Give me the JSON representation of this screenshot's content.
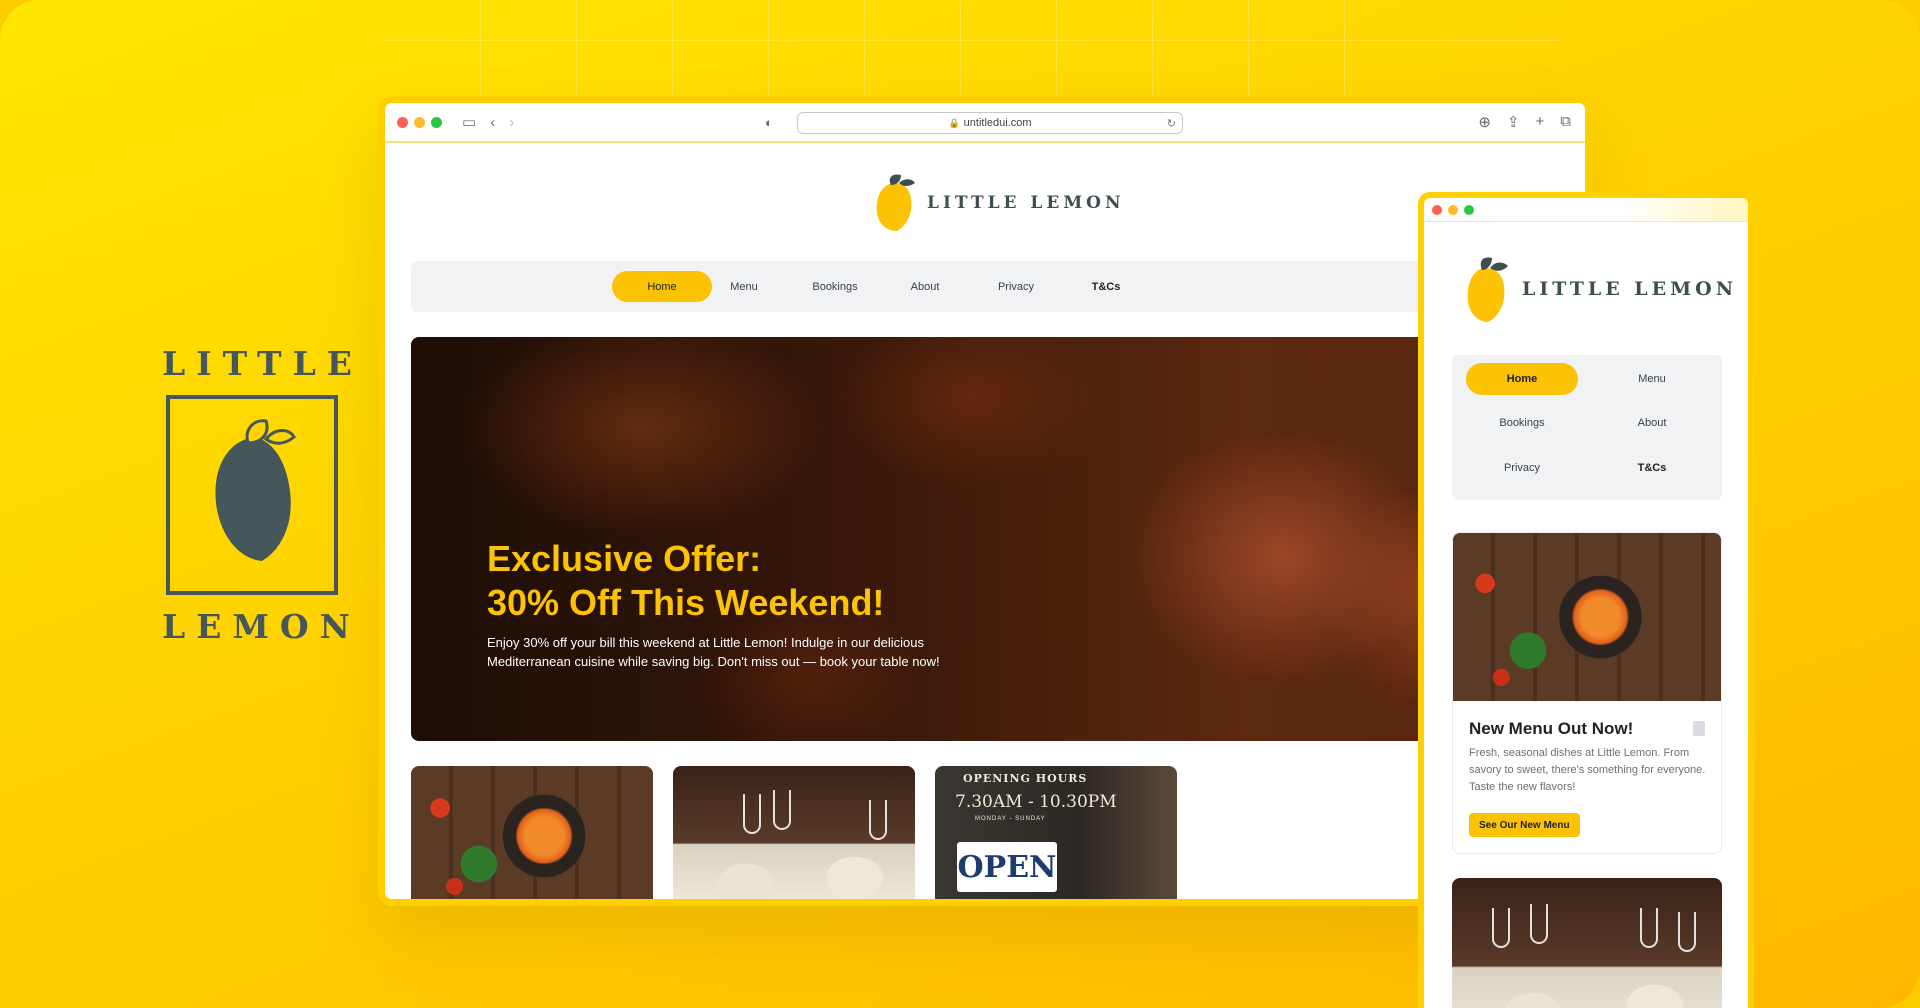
{
  "brand": {
    "word_top": "LITTLE",
    "word_bottom": "LEMON"
  },
  "browser": {
    "url": "untitledui.com"
  },
  "site": {
    "logo_text": "LITTLE LEMON",
    "nav": [
      {
        "label": "Home",
        "active": true
      },
      {
        "label": "Menu"
      },
      {
        "label": "Bookings"
      },
      {
        "label": "About"
      },
      {
        "label": "Privacy"
      },
      {
        "label": "T&Cs",
        "bold": true
      }
    ],
    "hero": {
      "title_line1": "Exclusive Offer:",
      "title_line2": "30% Off This Weekend!",
      "body": "Enjoy 30% off your bill this weekend at Little Lemon! Indulge in our delicious Mediterranean cuisine while saving big. Don't miss out — book your table now!"
    },
    "cards": [
      {
        "image": "pasta-dish"
      },
      {
        "image": "restaurant-table"
      },
      {
        "image": "open-sign",
        "sign_title": "OPENING HOURS",
        "sign_hours": "7.30AM - 10.30PM",
        "sign_days": "MONDAY - SUNDAY",
        "sign_open": "OPEN"
      }
    ]
  },
  "mobile": {
    "logo_text": "LITTLE LEMON",
    "nav": [
      {
        "label": "Home",
        "active": true
      },
      {
        "label": "Menu"
      },
      {
        "label": "Bookings"
      },
      {
        "label": "About"
      },
      {
        "label": "Privacy"
      },
      {
        "label": "T&Cs",
        "bold": true
      }
    ],
    "card": {
      "title": "New Menu Out Now!",
      "body": "Fresh, seasonal dishes at Little Lemon. From savory to sweet, there's something for everyone. Taste the new flavors!",
      "button": "See Our New Menu"
    }
  },
  "colors": {
    "accent": "#fcc204",
    "brand_dark": "#45575a",
    "background": "#ffd200"
  }
}
